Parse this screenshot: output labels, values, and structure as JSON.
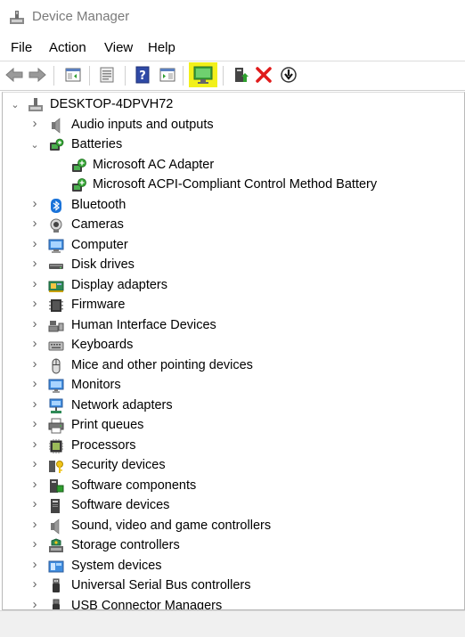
{
  "window": {
    "title": "Device Manager"
  },
  "menu": [
    "File",
    "Action",
    "View",
    "Help"
  ],
  "toolbar": {
    "buttons": [
      "back",
      "forward",
      "show-hide-console-tree",
      "properties",
      "help",
      "action-pane",
      "scan-for-hardware-changes",
      "update-driver",
      "uninstall-device",
      "disable-device"
    ],
    "highlight_color": "#f2f01a"
  },
  "tree": {
    "root": "DESKTOP-4DPVH72",
    "categories": [
      {
        "label": "Audio inputs and outputs",
        "icon": "speaker-icon",
        "expanded": false
      },
      {
        "label": "Batteries",
        "icon": "battery-icon",
        "expanded": true,
        "children": [
          "Microsoft AC Adapter",
          "Microsoft ACPI-Compliant Control Method Battery"
        ]
      },
      {
        "label": "Bluetooth",
        "icon": "bluetooth-icon",
        "expanded": false
      },
      {
        "label": "Cameras",
        "icon": "camera-icon",
        "expanded": false
      },
      {
        "label": "Computer",
        "icon": "computer-icon",
        "expanded": false
      },
      {
        "label": "Disk drives",
        "icon": "disk-drive-icon",
        "expanded": false
      },
      {
        "label": "Display adapters",
        "icon": "display-adapter-icon",
        "expanded": false
      },
      {
        "label": "Firmware",
        "icon": "firmware-icon",
        "expanded": false
      },
      {
        "label": "Human Interface Devices",
        "icon": "hid-icon",
        "expanded": false
      },
      {
        "label": "Keyboards",
        "icon": "keyboard-icon",
        "expanded": false
      },
      {
        "label": "Mice and other pointing devices",
        "icon": "mouse-icon",
        "expanded": false
      },
      {
        "label": "Monitors",
        "icon": "monitor-icon",
        "expanded": false
      },
      {
        "label": "Network adapters",
        "icon": "network-adapter-icon",
        "expanded": false
      },
      {
        "label": "Print queues",
        "icon": "printer-icon",
        "expanded": false
      },
      {
        "label": "Processors",
        "icon": "processor-icon",
        "expanded": false
      },
      {
        "label": "Security devices",
        "icon": "security-key-icon",
        "expanded": false
      },
      {
        "label": "Software components",
        "icon": "software-component-icon",
        "expanded": false
      },
      {
        "label": "Software devices",
        "icon": "software-device-icon",
        "expanded": false
      },
      {
        "label": "Sound, video and game controllers",
        "icon": "sound-icon",
        "expanded": false
      },
      {
        "label": "Storage controllers",
        "icon": "storage-controller-icon",
        "expanded": false
      },
      {
        "label": "System devices",
        "icon": "system-devices-icon",
        "expanded": false
      },
      {
        "label": "Universal Serial Bus controllers",
        "icon": "usb-icon",
        "expanded": false
      },
      {
        "label": "USB Connector Managers",
        "icon": "usb-connector-icon",
        "expanded": false
      }
    ]
  }
}
